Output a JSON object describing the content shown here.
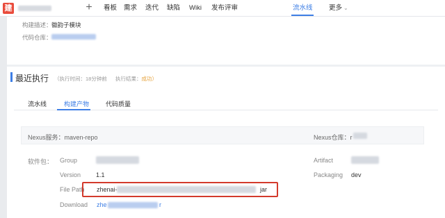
{
  "nav": {
    "project_name": "",
    "items": [
      {
        "label": "看板"
      },
      {
        "label": "需求"
      },
      {
        "label": "迭代"
      },
      {
        "label": "缺陷"
      },
      {
        "label": "Wiki"
      },
      {
        "label": "发布评审"
      },
      {
        "label": "流水线"
      },
      {
        "label": "更多"
      }
    ],
    "active": "流水线"
  },
  "build_info": {
    "desc_label": "构建描述：",
    "desc_value": "徽韵子模块",
    "repo_label": "代码仓库："
  },
  "recent_run": {
    "title": "最近执行",
    "exec_time": "（执行时间：18分钟前",
    "exec_result_label": "执行结果：",
    "exec_result_value": "成功）"
  },
  "tabs": [
    {
      "label": "流水线"
    },
    {
      "label": "构建产物"
    },
    {
      "label": "代码质量"
    }
  ],
  "active_tab": "构建产物",
  "nexus": {
    "service": "Nexus服务：maven-repo",
    "repo_label": "Nexus仓库：r"
  },
  "package": {
    "section_label": "软件包：",
    "group_label": "Group",
    "version_label": "Version",
    "version_value": "1.1",
    "file_path_label": "File Path",
    "file_path_prefix": "zhenai-",
    "file_path_suffix": "jar",
    "download_label": "Download",
    "download_prefix": "zhe",
    "download_suffix": "r",
    "artifact_label": "Artifact",
    "packaging_label": "Packaging",
    "packaging_value": "dev"
  },
  "colors": {
    "accent": "#3d7ee5",
    "logo": "#e94b3c",
    "highlight_border": "#d33a2c",
    "success": "#e6a23c"
  }
}
